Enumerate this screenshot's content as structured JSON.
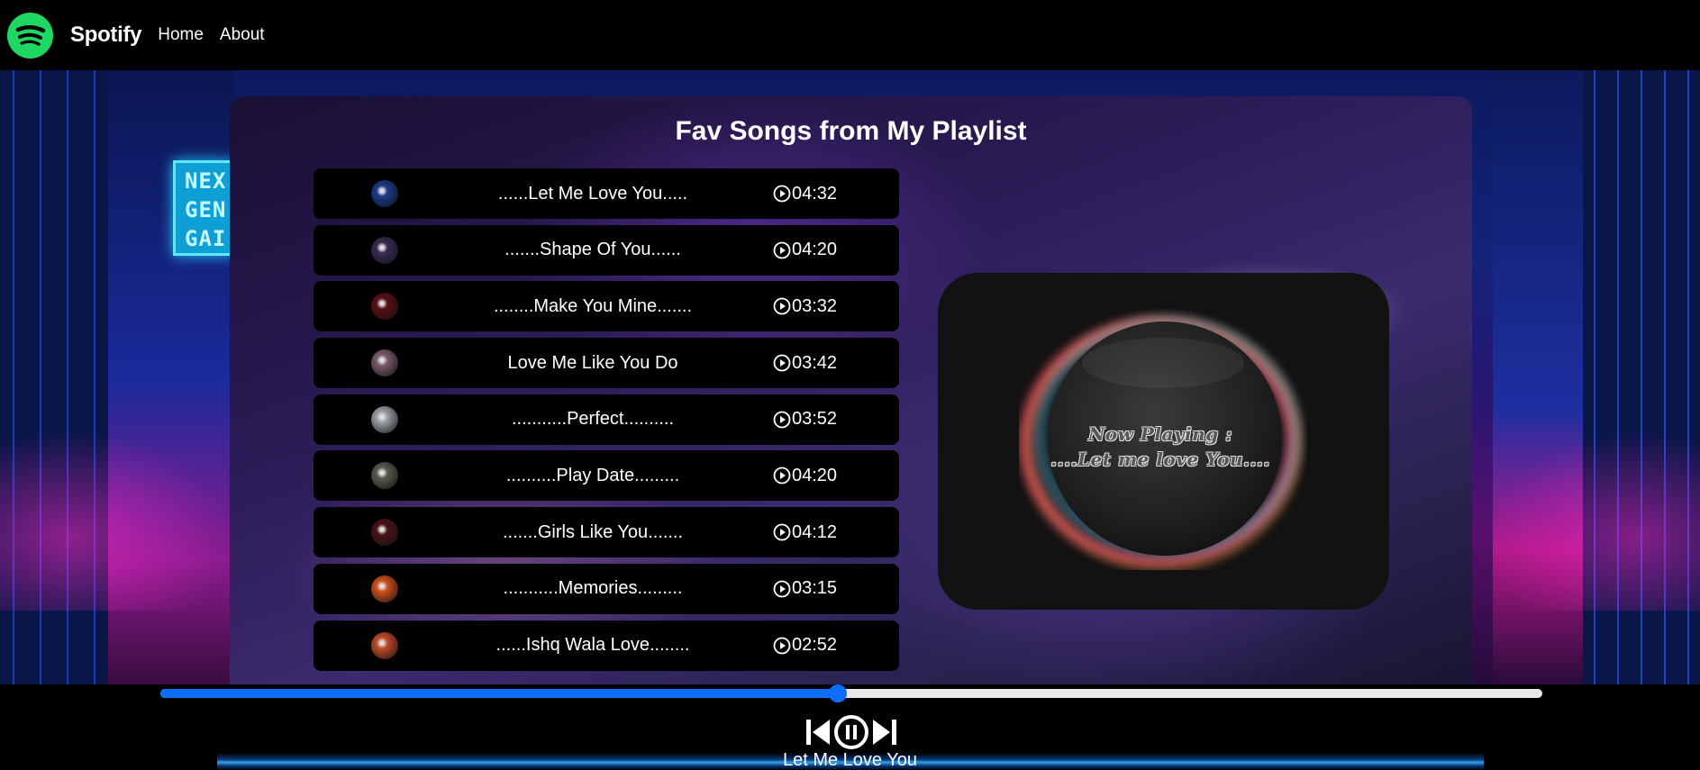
{
  "navbar": {
    "brand": "Spotify",
    "links": [
      "Home",
      "About"
    ],
    "logo_icon": "spotify-logo-icon"
  },
  "background": {
    "neon_sign_lines": [
      "NEX",
      "GEN",
      "GAI"
    ]
  },
  "panel": {
    "title": "Fav Songs from My Playlist"
  },
  "songs": [
    {
      "name": "......Let Me Love You.....",
      "duration": "04:32",
      "cover_color": "#1a3a8a"
    },
    {
      "name": ".......Shape Of You......",
      "duration": "04:20",
      "cover_color": "#3a2a55"
    },
    {
      "name": "........Make You Mine.......",
      "duration": "03:32",
      "cover_color": "#5a0f12"
    },
    {
      "name": "Love Me Like You Do",
      "duration": "03:42",
      "cover_color": "#7a5a6e"
    },
    {
      "name": "...........Perfect..........",
      "duration": "03:52",
      "cover_color": "#9aa0a6"
    },
    {
      "name": "..........Play Date.........",
      "duration": "04:20",
      "cover_color": "#5a5a50"
    },
    {
      "name": ".......Girls Like You.......",
      "duration": "04:12",
      "cover_color": "#4a1218"
    },
    {
      "name": "...........Memories.........",
      "duration": "03:15",
      "cover_color": "#d0501a"
    },
    {
      "name": "......Ishq Wala Love........",
      "duration": "02:52",
      "cover_color": "#c04a2a"
    }
  ],
  "now_playing_card": {
    "line1": "Now Playing :",
    "line2": "....Let me love You...."
  },
  "player": {
    "progress": 0.49,
    "current_song": "Let Me Love You",
    "accent_color": "#0d6efd",
    "icons": [
      "previous-icon",
      "pause-icon",
      "next-icon"
    ]
  }
}
